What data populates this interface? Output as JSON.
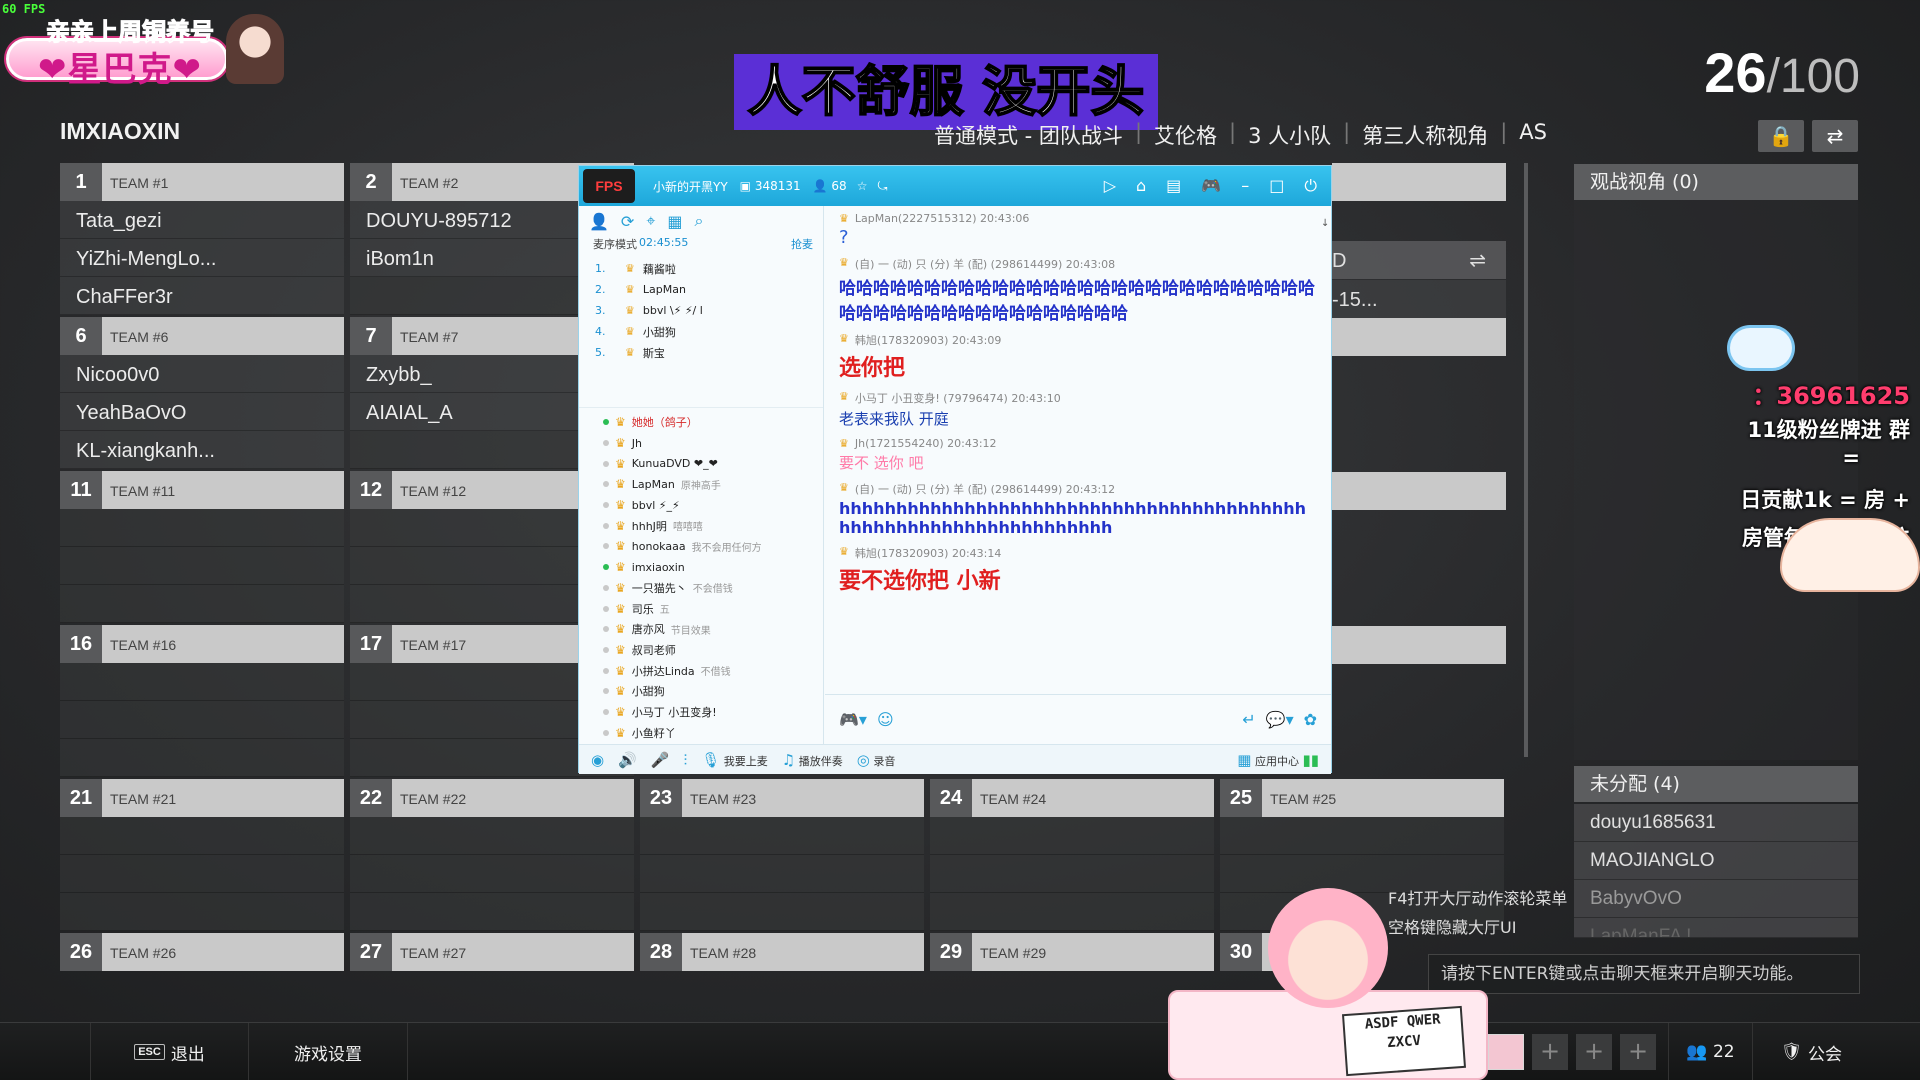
{
  "overlay": {
    "fps": "60 FPS",
    "badge_line1": "亲亲上周铜养号",
    "badge_line2": "❤星巴克❤",
    "subtitle": "人不舒服 没开头"
  },
  "header": {
    "player_name": "IMXIAOXIN",
    "mode": [
      "普通模式 - 团队战斗",
      "艾伦格",
      "3 人小队",
      "第三人称视角",
      "AS"
    ],
    "count_current": "26",
    "count_total": "/100"
  },
  "teams": [
    {
      "num": "1",
      "name": "TEAM #1",
      "players": [
        "Tata_gezi",
        "YiZhi-MengLo...",
        "ChaFFer3r"
      ]
    },
    {
      "num": "2",
      "name": "TEAM #2",
      "players": [
        "DOUYU-895712",
        "iBom1n",
        ""
      ]
    },
    {
      "num": "6",
      "name": "TEAM #6",
      "players": [
        "Nicoo0v0",
        "YeahBaOvO",
        "KL-xiangkanh..."
      ]
    },
    {
      "num": "7",
      "name": "TEAM #7",
      "players": [
        "Zxybb_",
        "AIAIAL_A",
        ""
      ]
    },
    {
      "num": "11",
      "name": "TEAM #11",
      "players": [
        "",
        "",
        ""
      ]
    },
    {
      "num": "12",
      "name": "TEAM #12",
      "players": [
        "",
        "",
        ""
      ]
    },
    {
      "num": "16",
      "name": "TEAM #16",
      "players": [
        "",
        "",
        ""
      ]
    },
    {
      "num": "17",
      "name": "TEAM #17",
      "players": [
        "",
        "",
        ""
      ]
    },
    {
      "num": "21",
      "name": "TEAM #21",
      "players": [
        "",
        "",
        ""
      ]
    },
    {
      "num": "22",
      "name": "TEAM #22",
      "players": [
        "",
        "",
        ""
      ]
    },
    {
      "num": "23",
      "name": "TEAM #23",
      "players": [
        "",
        "",
        ""
      ]
    },
    {
      "num": "24",
      "name": "TEAM #24",
      "players": [
        "",
        "",
        ""
      ]
    },
    {
      "num": "25",
      "name": "TEAM #25",
      "players": [
        "",
        "",
        ""
      ]
    },
    {
      "num": "26",
      "name": "TEAM #26",
      "players": []
    },
    {
      "num": "27",
      "name": "TEAM #27",
      "players": []
    },
    {
      "num": "28",
      "name": "TEAM #28",
      "players": []
    },
    {
      "num": "29",
      "name": "TEAM #29",
      "players": []
    },
    {
      "num": "30",
      "name": "T",
      "players": []
    }
  ],
  "partial_rows": {
    "team5_slot1": "D",
    "team5_slot2": "-15..."
  },
  "right_panel": {
    "spectator_header": "观战视角 (0)",
    "unassigned_header": "未分配 (4)",
    "unassigned": [
      "douyu1685631",
      "MAOJIANGLO",
      "BabyvOvO",
      "LapManFA !"
    ],
    "chat_hint": "请按下ENTER键或点击聊天框来开启聊天功能。",
    "f4_hint_1": "F4打开大厅动作滚轮菜单",
    "f4_hint_2": "空格键隐藏大厅UI"
  },
  "fan_overlay": {
    "qq": "：36961625",
    "line1": "11级粉丝牌进 群",
    "line2": "=",
    "line3": "日贡献1k = 房 +",
    "line4": "房管每周一次年位"
  },
  "yy": {
    "logo": "FPS",
    "title": "小新的开黑YY",
    "channel_id": "348131",
    "online": "68",
    "queue_mode": "麦序模式",
    "queue_time": "02:45:55",
    "queue_grab": "抢麦",
    "queue": [
      {
        "n": "1.",
        "name": "藕酱啦"
      },
      {
        "n": "2.",
        "name": "LapMan"
      },
      {
        "n": "3.",
        "name": "bbvl \\⚡ ⚡/ l"
      },
      {
        "n": "4.",
        "name": "小甜狗"
      },
      {
        "n": "5.",
        "name": "斯宝"
      }
    ],
    "members": [
      {
        "name": "她她（鸽子）",
        "tag": "",
        "red": true
      },
      {
        "name": "Jh",
        "tag": "",
        "red": false
      },
      {
        "name": "KunuaDVD ❤_❤",
        "tag": "",
        "red": false
      },
      {
        "name": "LapMan",
        "tag": "原神高手",
        "red": false
      },
      {
        "name": "bbvl ⚡_⚡",
        "tag": "",
        "red": false
      },
      {
        "name": "hhhJ明",
        "tag": "嘻嘻嘻",
        "red": false
      },
      {
        "name": "honokaaa",
        "tag": "我不会用任何方",
        "red": false
      },
      {
        "name": "imxiaoxin",
        "tag": "",
        "red": false
      },
      {
        "name": "一只猫先丶",
        "tag": "不会借钱",
        "red": false
      },
      {
        "name": "司乐",
        "tag": "五",
        "red": false
      },
      {
        "name": "唐亦风",
        "tag": "节目效果",
        "red": false
      },
      {
        "name": "叔司老师",
        "tag": "",
        "red": false
      },
      {
        "name": "小拼达Linda",
        "tag": "不借钱",
        "red": false
      },
      {
        "name": "小甜狗",
        "tag": "",
        "red": false
      },
      {
        "name": "小马丁 小丑变身!",
        "tag": "",
        "red": false
      },
      {
        "name": "小鱼籽丫",
        "tag": "",
        "red": false
      }
    ],
    "messages": [
      {
        "meta": "LapMan(2227515312)  20:43:06",
        "text": "?",
        "color": "#2a5fd6",
        "size": 18
      },
      {
        "meta": "(自) 一 (动) 只 (分) 羊 (配) (298614499)  20:43:08",
        "text": "哈哈哈哈哈哈哈哈哈哈哈哈哈哈哈哈哈哈哈哈哈哈哈哈哈哈哈哈哈哈哈哈哈哈哈哈哈哈哈哈哈哈哈哈哈",
        "color": "#2433c9",
        "size": 17
      },
      {
        "meta": "韩旭(178320903)  20:43:09",
        "text": "选你把",
        "color": "#e01f1f",
        "size": 22
      },
      {
        "meta": "小马丁 小丑变身!  (79796474)  20:43:10",
        "text": "老表来我队    开庭",
        "color": "#1a3fb0",
        "size": 15
      },
      {
        "meta": "Jh(1721554240)  20:43:12",
        "text": "要不 选你 吧",
        "color": "#ff7aa8",
        "size": 15
      },
      {
        "meta": "(自) 一 (动) 只 (分) 羊 (配) (298614499)  20:43:12",
        "text": "hhhhhhhhhhhhhhhhhhhhhhhhhhhhhhhhhhhhhhhhhhhhhhhhhhhhhhhhhhhhhhhhh",
        "color": "#2433c9",
        "size": 16
      },
      {
        "meta": "韩旭(178320903)  20:43:14",
        "text": "要不选你把  小新",
        "color": "#e01f1f",
        "size": 22
      }
    ],
    "bottom": [
      "我要上麦",
      "播放伴奏",
      "录音",
      "应用中心"
    ]
  },
  "bottom_bar": {
    "esc_key": "ESC",
    "exit": "退出",
    "settings": "游戏设置",
    "friends_count": "22",
    "clan": "公会"
  },
  "girl_sign": "ASDF QWER ZXCV"
}
